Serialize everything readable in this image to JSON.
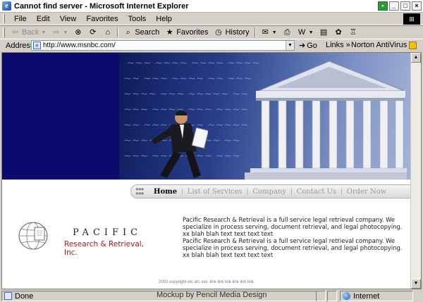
{
  "window": {
    "title": "Cannot find server - Microsoft Internet Explorer"
  },
  "menu": {
    "items": [
      "File",
      "Edit",
      "View",
      "Favorites",
      "Tools",
      "Help"
    ]
  },
  "toolbar": {
    "back_label": "Back",
    "search_label": "Search",
    "favorites_label": "Favorites",
    "history_label": "History"
  },
  "address": {
    "label": "Address",
    "url": "http://www.msnbc.com/",
    "go_label": "Go",
    "links_label": "Links",
    "norton_label": "Norton AntiVirus"
  },
  "site": {
    "nav": [
      "Home",
      "List of Services",
      "Company",
      "Contact Us",
      "Order Now"
    ],
    "logo_line1": "PACIFIC",
    "logo_line2": "Research & Retrieval, Inc.",
    "paragraphs": [
      "Pacific Research & Retrieval is a full service legal retrieval company. We specialize in process serving, document  retrieval, and legal photocopying. xx blah blah text text text text",
      "Pacific Research & Retrieval is a full service legal retrieval company. We specialize in process serving, document  retrieval, and legal photocopying. xx blah blah text text text text"
    ],
    "footer": "2002 copyright etc etc xxx. link link  link link  link link"
  },
  "status": {
    "left": "Done",
    "caption": "Mockup by Pencil Media Design",
    "zone": "Internet"
  }
}
